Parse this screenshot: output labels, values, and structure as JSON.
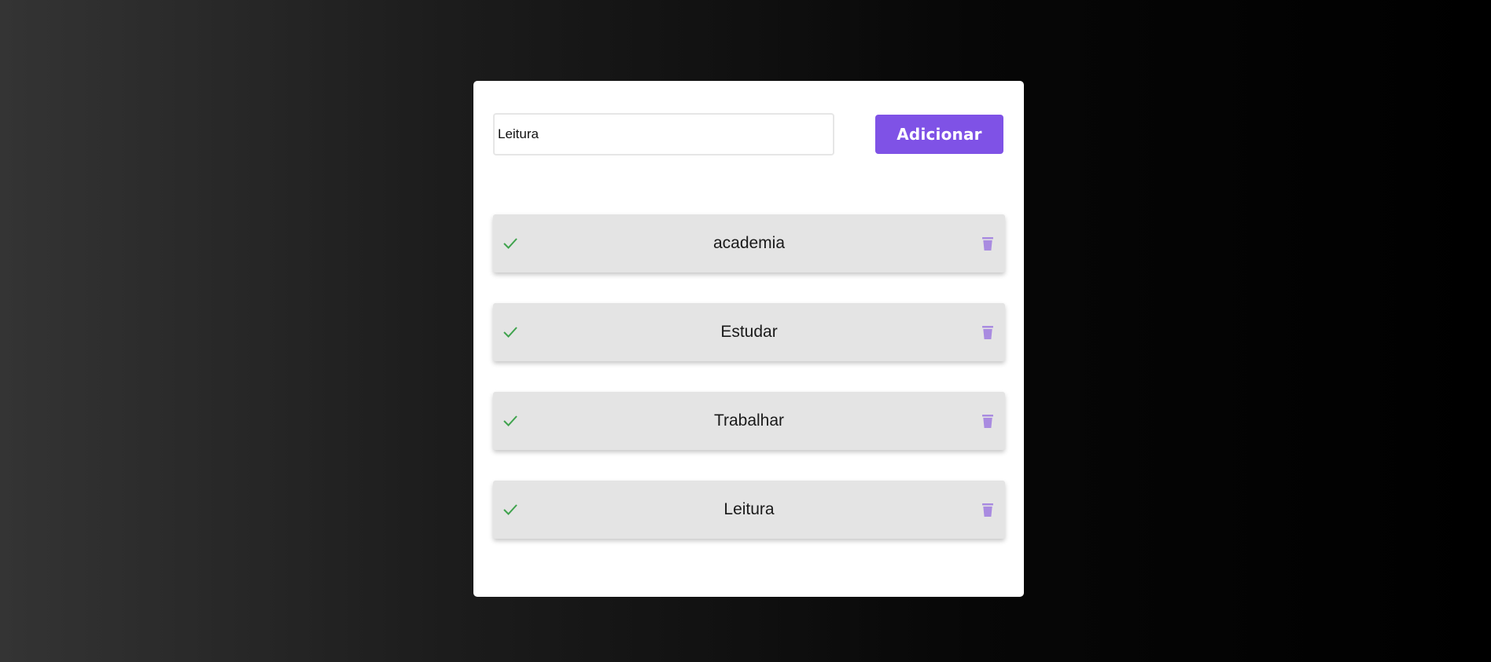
{
  "form": {
    "input_value": "Leitura",
    "add_label": "Adicionar"
  },
  "tasks": [
    {
      "label": "academia",
      "done_icon": "check-icon",
      "delete_icon": "trash-icon"
    },
    {
      "label": "Estudar",
      "done_icon": "check-icon",
      "delete_icon": "trash-icon"
    },
    {
      "label": "Trabalhar",
      "done_icon": "check-icon",
      "delete_icon": "trash-icon"
    },
    {
      "label": "Leitura",
      "done_icon": "check-icon",
      "delete_icon": "trash-icon"
    }
  ],
  "colors": {
    "accent": "#7f52e6",
    "check": "#3fa34d",
    "trash": "#a98be0",
    "item_background": "#e4e4e4"
  }
}
